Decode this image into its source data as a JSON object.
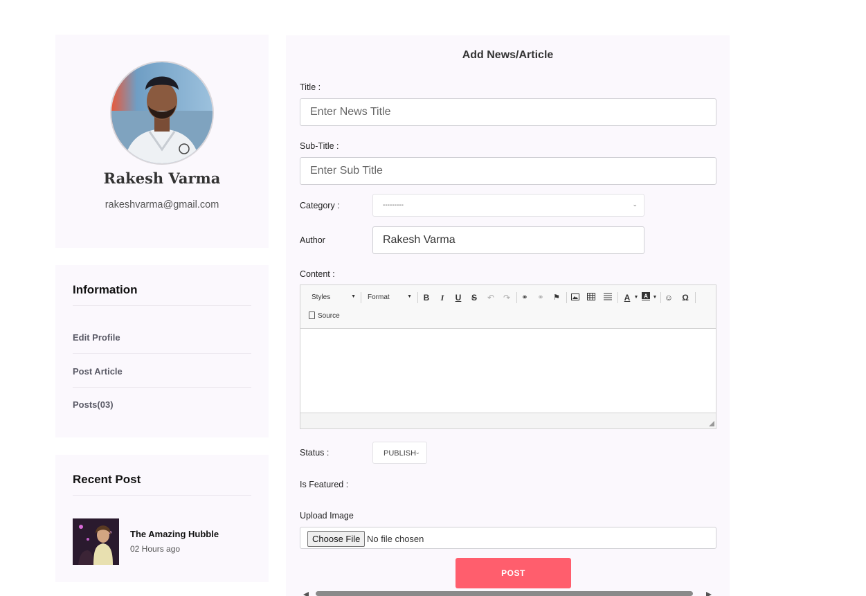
{
  "profile": {
    "name": "Rakesh Varma",
    "email": "rakeshvarma@gmail.com"
  },
  "information": {
    "heading": "Information",
    "links": [
      "Edit Profile",
      "Post Article",
      "Posts(03)"
    ]
  },
  "recent": {
    "heading": "Recent Post",
    "items": [
      {
        "title": "The Amazing Hubble",
        "time": "02 Hours ago"
      }
    ]
  },
  "form": {
    "title": "Add News/Article",
    "title_label": "Title :",
    "title_placeholder": "Enter News Title",
    "subtitle_label": "Sub-Title :",
    "subtitle_placeholder": "Enter Sub Title",
    "category_label": "Category :",
    "category_value": "---------",
    "author_label": "Author",
    "author_value": "Rakesh Varma",
    "content_label": "Content :",
    "editor": {
      "styles_label": "Styles",
      "format_label": "Format",
      "source_label": "Source"
    },
    "status_label": "Status :",
    "status_value": "PUBLISH",
    "featured_label": "Is Featured :",
    "upload_label": "Upload Image",
    "choose_file_label": "Choose File",
    "file_status": "No file chosen",
    "post_label": "POST"
  },
  "colors": {
    "accent": "#ff5e6d",
    "card_bg": "#fbf8fd"
  }
}
